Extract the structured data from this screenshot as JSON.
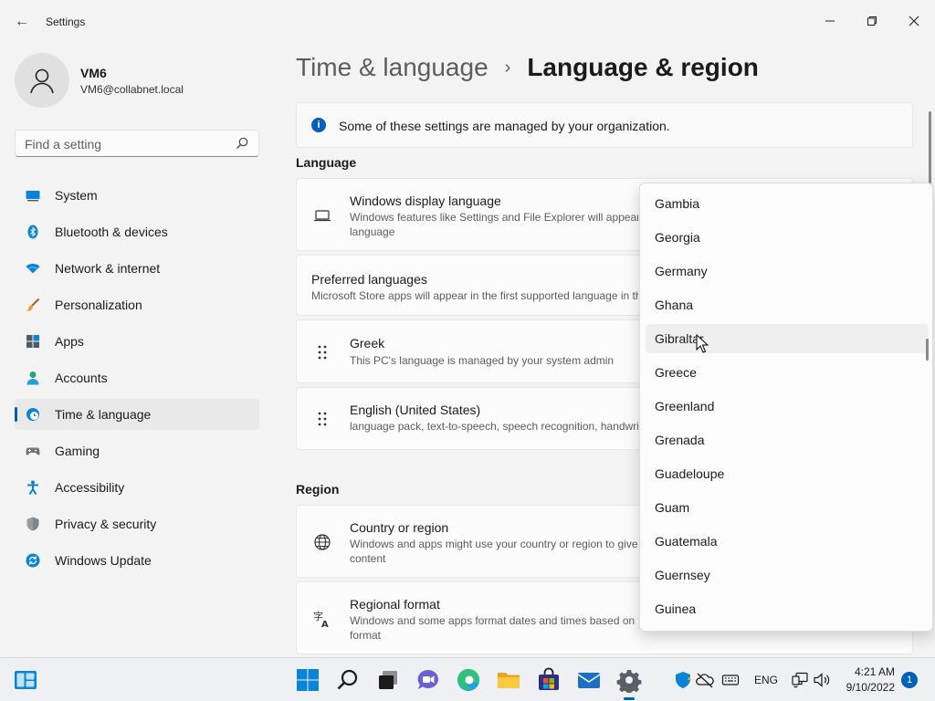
{
  "window": {
    "title": "Settings",
    "back_label": "←",
    "minimize_label": "—",
    "restore_label": "❐",
    "close_label": "✕"
  },
  "profile": {
    "name": "VM6",
    "email": "VM6@collabnet.local"
  },
  "search": {
    "placeholder": "Find a setting"
  },
  "nav": {
    "items": [
      {
        "label": "System",
        "icon": "system-icon"
      },
      {
        "label": "Bluetooth & devices",
        "icon": "bluetooth-icon"
      },
      {
        "label": "Network & internet",
        "icon": "network-icon"
      },
      {
        "label": "Personalization",
        "icon": "brush-icon"
      },
      {
        "label": "Apps",
        "icon": "apps-icon"
      },
      {
        "label": "Accounts",
        "icon": "accounts-icon"
      },
      {
        "label": "Time & language",
        "icon": "time-language-icon",
        "active": true
      },
      {
        "label": "Gaming",
        "icon": "gaming-icon"
      },
      {
        "label": "Accessibility",
        "icon": "accessibility-icon"
      },
      {
        "label": "Privacy & security",
        "icon": "shield-icon"
      },
      {
        "label": "Windows Update",
        "icon": "update-icon"
      }
    ]
  },
  "breadcrumb": {
    "parent": "Time & language",
    "separator": "›",
    "current": "Language & region"
  },
  "info_bar": {
    "text": "Some of these settings are managed by your organization."
  },
  "language_section": {
    "title": "Language",
    "display_language": {
      "title": "Windows display language",
      "desc_line1": "Windows features like Settings and File Explorer will appear in this",
      "desc_line2": "language"
    },
    "preferred": {
      "title": "Preferred languages",
      "desc": "Microsoft Store apps will appear in the first supported language in this list"
    },
    "languages": [
      {
        "title": "Greek",
        "desc": "This PC's language is managed by your system admin"
      },
      {
        "title": "English (United States)",
        "desc": "language pack, text-to-speech, speech recognition, handwriting"
      }
    ]
  },
  "region_section": {
    "title": "Region",
    "country": {
      "title": "Country or region",
      "desc_line1": "Windows and apps might use your country or region to give you local",
      "desc_line2": "content"
    },
    "format": {
      "title": "Regional format",
      "desc_line1": "Windows and some apps format dates and times based on your regional",
      "desc_line2": "format"
    }
  },
  "dropdown": {
    "items": [
      "Gambia",
      "Georgia",
      "Germany",
      "Ghana",
      "Gibraltar",
      "Greece",
      "Greenland",
      "Grenada",
      "Guadeloupe",
      "Guam",
      "Guatemala",
      "Guernsey",
      "Guinea"
    ],
    "hovered": "Gibraltar"
  },
  "taskbar": {
    "apps": [
      "widgets-icon",
      "start-icon",
      "search-icon",
      "task-view-icon",
      "chat-icon",
      "edge-icon",
      "file-explorer-icon",
      "store-icon",
      "mail-icon",
      "settings-icon"
    ],
    "tray": {
      "language": "ENG",
      "time": "4:21 AM",
      "date": "9/10/2022",
      "notifications": "1"
    }
  },
  "colors": {
    "accent": "#005fb8",
    "background": "#f3f3f3"
  }
}
